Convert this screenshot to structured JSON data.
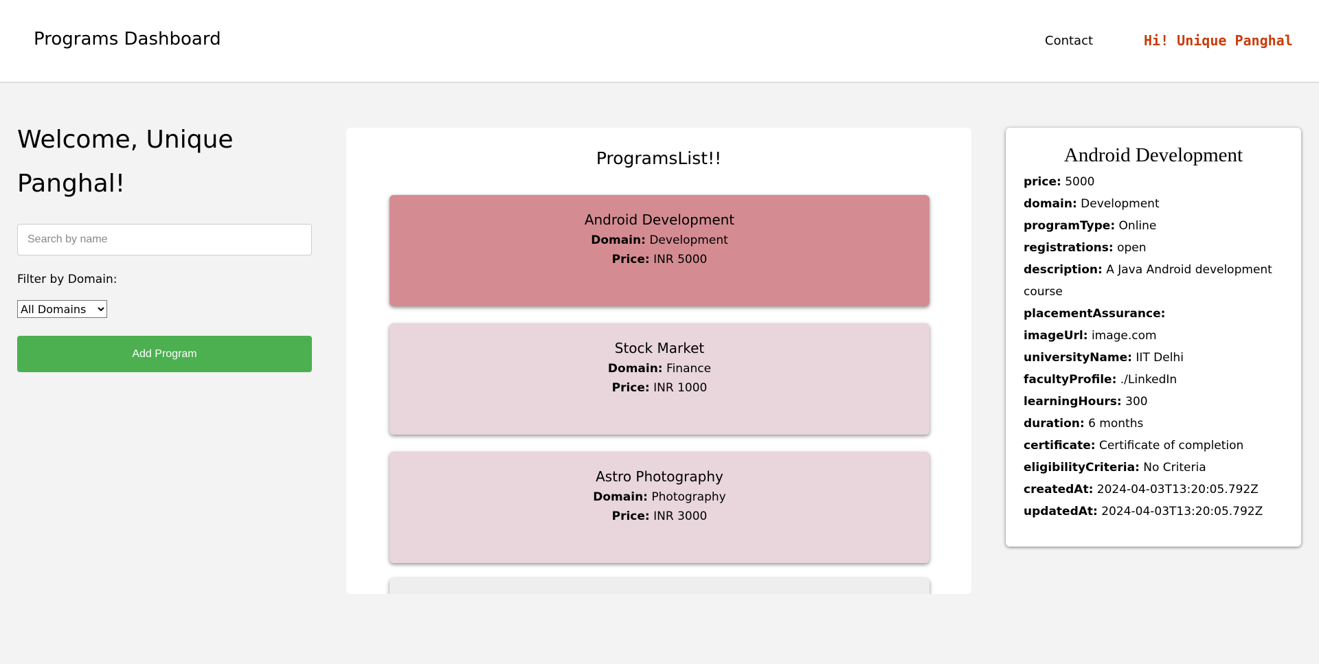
{
  "header": {
    "title": "Programs Dashboard",
    "contact": "Contact",
    "greeting": "Hi! Unique Panghal"
  },
  "sidebar": {
    "welcome": "Welcome, Unique Panghal!",
    "search_placeholder": "Search by name",
    "filter_label": "Filter by Domain:",
    "filter_value": "All Domains",
    "add_button": "Add Program"
  },
  "list": {
    "title": "ProgramsList!!",
    "domain_label": "Domain:",
    "price_label": "Price:",
    "selected_color": "#d48c92",
    "card_color": "#e8d6dc",
    "programs": [
      {
        "name": "Android Development",
        "domain": "Development",
        "price": "INR 5000"
      },
      {
        "name": "Stock Market",
        "domain": "Finance",
        "price": "INR 1000"
      },
      {
        "name": "Astro Photography",
        "domain": "Photography",
        "price": "INR 3000"
      }
    ]
  },
  "detail": {
    "title": "Android Development",
    "fields": [
      {
        "k": "price:",
        "v": "5000"
      },
      {
        "k": "domain:",
        "v": "Development"
      },
      {
        "k": "programType:",
        "v": "Online"
      },
      {
        "k": "registrations:",
        "v": "open"
      },
      {
        "k": "description:",
        "v": "A Java Android development course"
      },
      {
        "k": "placementAssurance:",
        "v": ""
      },
      {
        "k": "imageUrl:",
        "v": "image.com"
      },
      {
        "k": "universityName:",
        "v": "IIT Delhi"
      },
      {
        "k": "facultyProfile:",
        "v": "./LinkedIn"
      },
      {
        "k": "learningHours:",
        "v": "300"
      },
      {
        "k": "duration:",
        "v": "6 months"
      },
      {
        "k": "certificate:",
        "v": "Certificate of completion"
      },
      {
        "k": "eligibilityCriteria:",
        "v": "No Criteria"
      },
      {
        "k": "createdAt:",
        "v": "2024-04-03T13:20:05.792Z"
      },
      {
        "k": "updatedAt:",
        "v": "2024-04-03T13:20:05.792Z"
      }
    ]
  }
}
